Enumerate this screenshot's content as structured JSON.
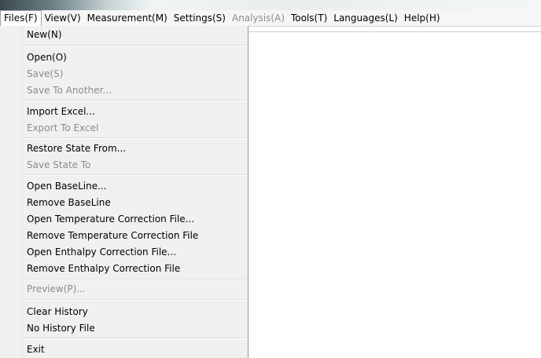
{
  "menubar": {
    "items": [
      {
        "label": "Files(F)",
        "enabled": true,
        "active": true
      },
      {
        "label": "View(V)",
        "enabled": true
      },
      {
        "label": "Measurement(M)",
        "enabled": true
      },
      {
        "label": "Settings(S)",
        "enabled": true
      },
      {
        "label": "Analysis(A)",
        "enabled": false
      },
      {
        "label": "Tools(T)",
        "enabled": true
      },
      {
        "label": "Languages(L)",
        "enabled": true
      },
      {
        "label": "Help(H)",
        "enabled": true
      }
    ]
  },
  "files_menu": {
    "items": [
      {
        "label": "New(N)",
        "enabled": true
      },
      {
        "label": "Open(O)",
        "enabled": true
      },
      {
        "label": "Save(S)",
        "enabled": false
      },
      {
        "label": "Save To Another...",
        "enabled": false
      },
      {
        "label": "Import Excel...",
        "enabled": true
      },
      {
        "label": "Export To Excel",
        "enabled": false
      },
      {
        "label": "Restore State From...",
        "enabled": true
      },
      {
        "label": "Save State To",
        "enabled": false
      },
      {
        "label": "Open BaseLine...",
        "enabled": true
      },
      {
        "label": "Remove BaseLine",
        "enabled": true
      },
      {
        "label": "Open Temperature Correction File...",
        "enabled": true
      },
      {
        "label": "Remove Temperature Correction File",
        "enabled": true
      },
      {
        "label": "Open Enthalpy Correction File...",
        "enabled": true
      },
      {
        "label": "Remove Enthalpy Correction File",
        "enabled": true
      },
      {
        "label": "Preview(P)...",
        "enabled": false
      },
      {
        "label": "Clear History",
        "enabled": true
      },
      {
        "label": "No History File",
        "enabled": true
      },
      {
        "label": "Exit",
        "enabled": true
      }
    ]
  }
}
